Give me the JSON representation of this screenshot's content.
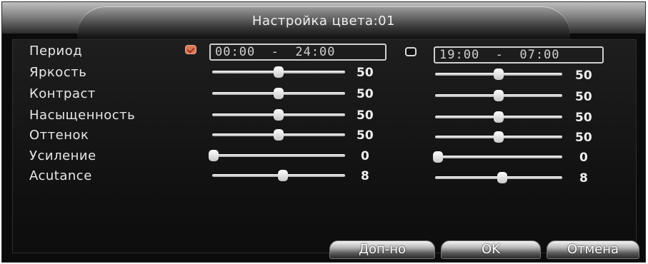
{
  "window": {
    "title": "Настройка цвета:01"
  },
  "labels": {
    "period": "Период",
    "brightness": "Яркость",
    "contrast": "Контраст",
    "saturation": "Насыщенность",
    "hue": "Оттенок",
    "gain": "Усиление",
    "acutance": "Acutance"
  },
  "period1": {
    "checked": true,
    "time": "00:00  -  24:00"
  },
  "period2": {
    "checked": false,
    "time": "19:00  -  07:00"
  },
  "values": {
    "period1": {
      "brightness": "50",
      "contrast": "50",
      "saturation": "50",
      "hue": "50",
      "gain": "0",
      "acutance": "8"
    },
    "period2": {
      "brightness": "50",
      "contrast": "50",
      "saturation": "50",
      "hue": "50",
      "gain": "0",
      "acutance": "8"
    }
  },
  "slider_levels": {
    "period1": {
      "brightness": 0.5,
      "contrast": 0.5,
      "saturation": 0.5,
      "hue": 0.5,
      "gain": 0.0,
      "acutance": 0.53
    },
    "period2": {
      "brightness": 0.5,
      "contrast": 0.5,
      "saturation": 0.5,
      "hue": 0.5,
      "gain": 0.0,
      "acutance": 0.53
    }
  },
  "buttons": {
    "advanced": "Доп-но",
    "ok": "OK",
    "cancel": "Отмена"
  },
  "colors": {
    "background": "#0b0b0b",
    "text": "#e8e8e8",
    "checked": "#d87858"
  }
}
